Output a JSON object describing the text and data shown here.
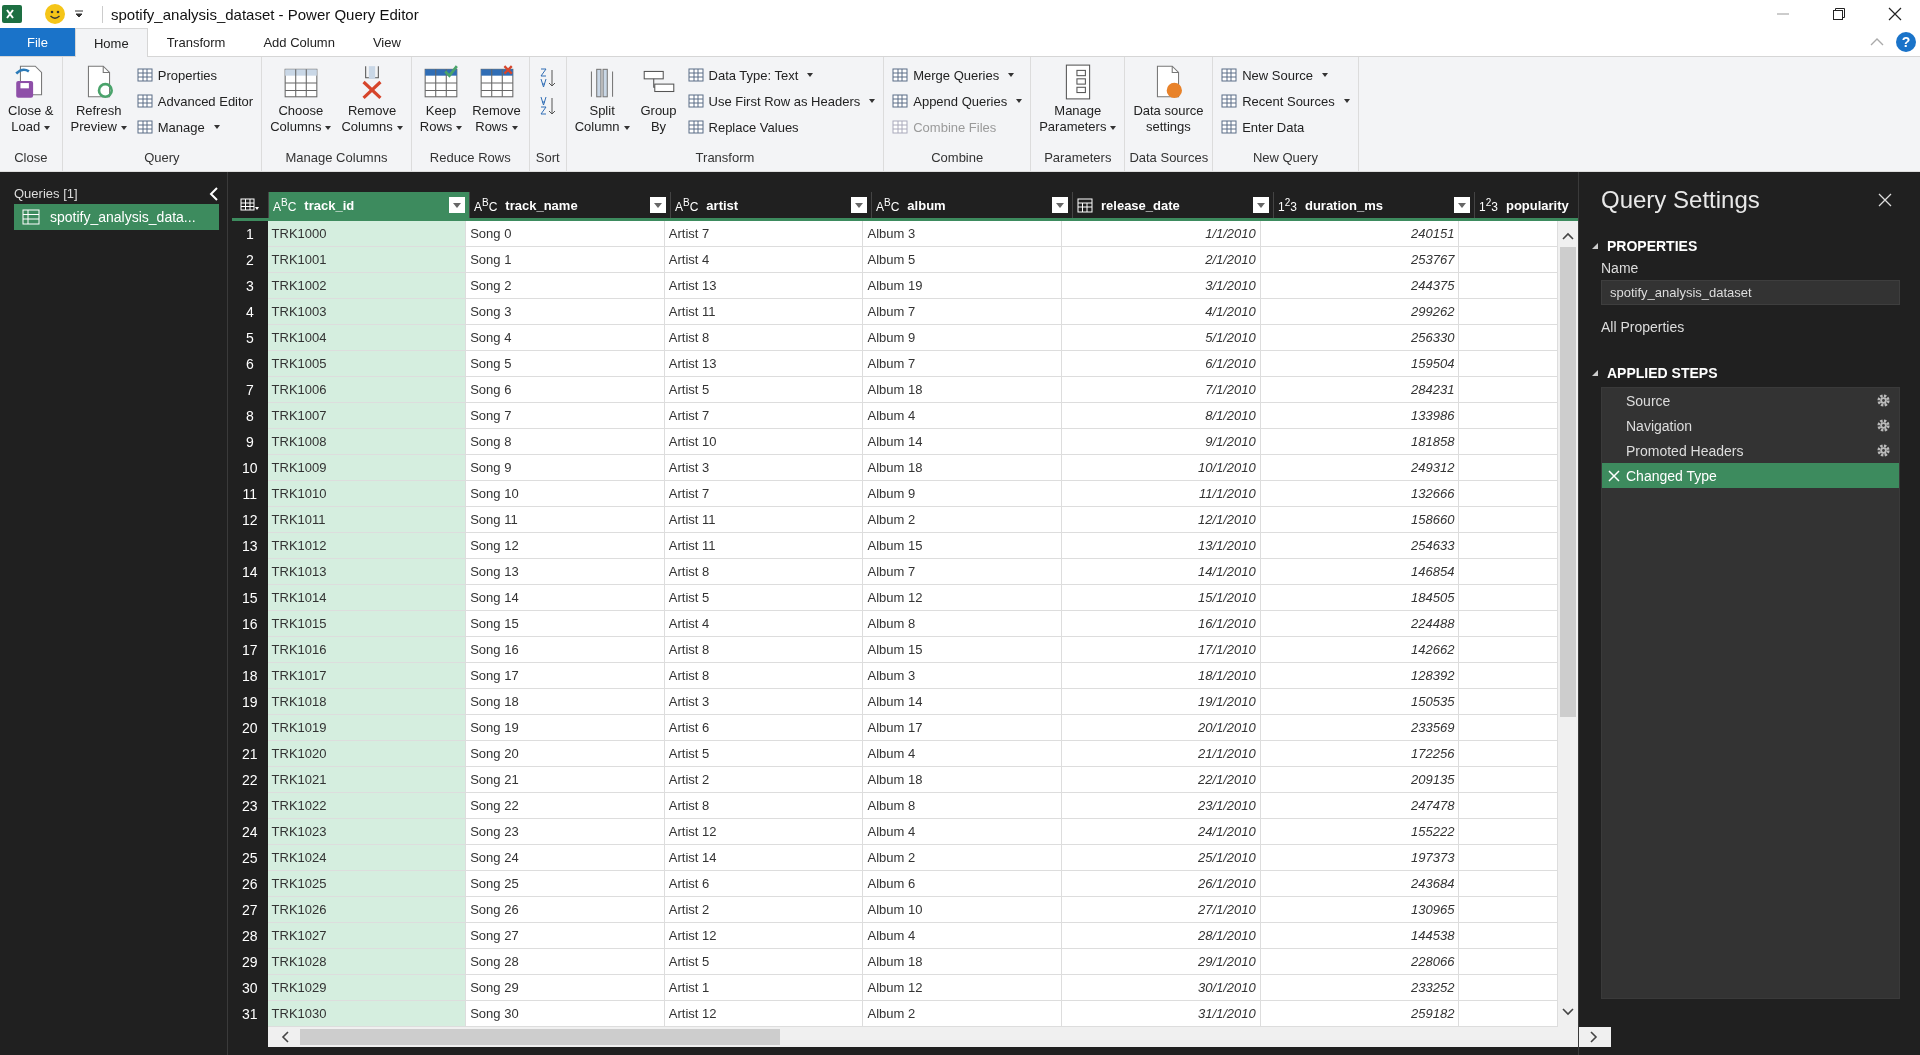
{
  "window": {
    "title": "spotify_analysis_dataset - Power Query Editor",
    "help": "?"
  },
  "tabs": [
    {
      "label": "File",
      "kind": "file",
      "selected": false
    },
    {
      "label": "Home",
      "kind": "tab",
      "selected": true
    },
    {
      "label": "Transform",
      "kind": "tab",
      "selected": false
    },
    {
      "label": "Add Column",
      "kind": "tab",
      "selected": false
    },
    {
      "label": "View",
      "kind": "tab",
      "selected": false
    }
  ],
  "ribbon": {
    "groups": [
      {
        "label": "Close",
        "columns": [
          {
            "kind": "large",
            "lines": [
              "Close &",
              "Load"
            ],
            "dropdown": true
          }
        ]
      },
      {
        "label": "Query",
        "columns": [
          {
            "kind": "large",
            "lines": [
              "Refresh",
              "Preview"
            ],
            "dropdown": true
          },
          {
            "kind": "stack",
            "items": [
              {
                "label": "Properties",
                "dropdown": false,
                "disabled": false
              },
              {
                "label": "Advanced Editor",
                "dropdown": false,
                "disabled": false
              },
              {
                "label": "Manage",
                "dropdown": true,
                "disabled": false
              }
            ]
          }
        ]
      },
      {
        "label": "Manage Columns",
        "columns": [
          {
            "kind": "large",
            "lines": [
              "Choose",
              "Columns"
            ],
            "dropdown": true
          },
          {
            "kind": "large",
            "lines": [
              "Remove",
              "Columns"
            ],
            "dropdown": true
          }
        ]
      },
      {
        "label": "Reduce Rows",
        "columns": [
          {
            "kind": "large",
            "lines": [
              "Keep",
              "Rows"
            ],
            "dropdown": true
          },
          {
            "kind": "large",
            "lines": [
              "Remove",
              "Rows"
            ],
            "dropdown": true
          }
        ]
      },
      {
        "label": "Sort",
        "columns": [
          {
            "kind": "sort"
          }
        ]
      },
      {
        "label": "Transform",
        "columns": [
          {
            "kind": "large",
            "lines": [
              "Split",
              "Column"
            ],
            "dropdown": true
          },
          {
            "kind": "large",
            "lines": [
              "Group",
              "By"
            ],
            "dropdown": false
          },
          {
            "kind": "stack",
            "items": [
              {
                "label": "Data Type: Text",
                "dropdown": true,
                "disabled": false
              },
              {
                "label": "Use First Row as Headers",
                "dropdown": true,
                "disabled": false
              },
              {
                "label": "Replace Values",
                "dropdown": false,
                "disabled": false
              }
            ]
          }
        ]
      },
      {
        "label": "Combine",
        "columns": [
          {
            "kind": "stack",
            "items": [
              {
                "label": "Merge Queries",
                "dropdown": true,
                "disabled": false
              },
              {
                "label": "Append Queries",
                "dropdown": true,
                "disabled": false
              },
              {
                "label": "Combine Files",
                "dropdown": false,
                "disabled": true
              }
            ]
          }
        ]
      },
      {
        "label": "Parameters",
        "columns": [
          {
            "kind": "large",
            "lines": [
              "Manage",
              "Parameters"
            ],
            "dropdown": true
          }
        ]
      },
      {
        "label": "Data Sources",
        "columns": [
          {
            "kind": "large",
            "lines": [
              "Data source",
              "settings"
            ],
            "dropdown": false
          }
        ]
      },
      {
        "label": "New Query",
        "columns": [
          {
            "kind": "stack",
            "items": [
              {
                "label": "New Source",
                "dropdown": true,
                "disabled": false
              },
              {
                "label": "Recent Sources",
                "dropdown": true,
                "disabled": false
              },
              {
                "label": "Enter Data",
                "dropdown": false,
                "disabled": false
              }
            ]
          }
        ]
      }
    ]
  },
  "queries": {
    "title": "Queries [1]",
    "items": [
      {
        "label": "spotify_analysis_data...",
        "selected": true
      }
    ]
  },
  "table": {
    "columns": [
      {
        "name": "track_id",
        "kind": "text",
        "badge": "A$^{B}$C",
        "selected": true
      },
      {
        "name": "track_name",
        "kind": "text",
        "badge": "A$^{B}$C",
        "selected": false
      },
      {
        "name": "artist",
        "kind": "text",
        "badge": "A$^{B}$C",
        "selected": false
      },
      {
        "name": "album",
        "kind": "text",
        "badge": "A$^{B}$C",
        "selected": false
      },
      {
        "name": "release_date",
        "kind": "date",
        "selected": false
      },
      {
        "name": "duration_ms",
        "kind": "number",
        "badge": "1$^{2}$3",
        "selected": false
      },
      {
        "name": "popularity",
        "kind": "number",
        "badge": "1$^{2}$3",
        "selected": false
      }
    ],
    "rows": [
      {
        "n": "1",
        "cells": [
          "TRK1000",
          "Song 0",
          "Artist 7",
          "Album 3",
          "1/1/2010",
          "240151"
        ]
      },
      {
        "n": "2",
        "cells": [
          "TRK1001",
          "Song 1",
          "Artist 4",
          "Album 5",
          "2/1/2010",
          "253767"
        ]
      },
      {
        "n": "3",
        "cells": [
          "TRK1002",
          "Song 2",
          "Artist 13",
          "Album 19",
          "3/1/2010",
          "244375"
        ]
      },
      {
        "n": "4",
        "cells": [
          "TRK1003",
          "Song 3",
          "Artist 11",
          "Album 7",
          "4/1/2010",
          "299262"
        ]
      },
      {
        "n": "5",
        "cells": [
          "TRK1004",
          "Song 4",
          "Artist 8",
          "Album 9",
          "5/1/2010",
          "256330"
        ]
      },
      {
        "n": "6",
        "cells": [
          "TRK1005",
          "Song 5",
          "Artist 13",
          "Album 7",
          "6/1/2010",
          "159504"
        ]
      },
      {
        "n": "7",
        "cells": [
          "TRK1006",
          "Song 6",
          "Artist 5",
          "Album 18",
          "7/1/2010",
          "284231"
        ]
      },
      {
        "n": "8",
        "cells": [
          "TRK1007",
          "Song 7",
          "Artist 7",
          "Album 4",
          "8/1/2010",
          "133986"
        ]
      },
      {
        "n": "9",
        "cells": [
          "TRK1008",
          "Song 8",
          "Artist 10",
          "Album 14",
          "9/1/2010",
          "181858"
        ]
      },
      {
        "n": "10",
        "cells": [
          "TRK1009",
          "Song 9",
          "Artist 3",
          "Album 18",
          "10/1/2010",
          "249312"
        ]
      },
      {
        "n": "11",
        "cells": [
          "TRK1010",
          "Song 10",
          "Artist 7",
          "Album 9",
          "11/1/2010",
          "132666"
        ]
      },
      {
        "n": "12",
        "cells": [
          "TRK1011",
          "Song 11",
          "Artist 11",
          "Album 2",
          "12/1/2010",
          "158660"
        ]
      },
      {
        "n": "13",
        "cells": [
          "TRK1012",
          "Song 12",
          "Artist 11",
          "Album 15",
          "13/1/2010",
          "254633"
        ]
      },
      {
        "n": "14",
        "cells": [
          "TRK1013",
          "Song 13",
          "Artist 8",
          "Album 7",
          "14/1/2010",
          "146854"
        ]
      },
      {
        "n": "15",
        "cells": [
          "TRK1014",
          "Song 14",
          "Artist 5",
          "Album 12",
          "15/1/2010",
          "184505"
        ]
      },
      {
        "n": "16",
        "cells": [
          "TRK1015",
          "Song 15",
          "Artist 4",
          "Album 8",
          "16/1/2010",
          "224488"
        ]
      },
      {
        "n": "17",
        "cells": [
          "TRK1016",
          "Song 16",
          "Artist 8",
          "Album 15",
          "17/1/2010",
          "142662"
        ]
      },
      {
        "n": "18",
        "cells": [
          "TRK1017",
          "Song 17",
          "Artist 8",
          "Album 3",
          "18/1/2010",
          "128392"
        ]
      },
      {
        "n": "19",
        "cells": [
          "TRK1018",
          "Song 18",
          "Artist 3",
          "Album 14",
          "19/1/2010",
          "150535"
        ]
      },
      {
        "n": "20",
        "cells": [
          "TRK1019",
          "Song 19",
          "Artist 6",
          "Album 17",
          "20/1/2010",
          "233569"
        ]
      },
      {
        "n": "21",
        "cells": [
          "TRK1020",
          "Song 20",
          "Artist 5",
          "Album 4",
          "21/1/2010",
          "172256"
        ]
      },
      {
        "n": "22",
        "cells": [
          "TRK1021",
          "Song 21",
          "Artist 2",
          "Album 18",
          "22/1/2010",
          "209135"
        ]
      },
      {
        "n": "23",
        "cells": [
          "TRK1022",
          "Song 22",
          "Artist 8",
          "Album 8",
          "23/1/2010",
          "247478"
        ]
      },
      {
        "n": "24",
        "cells": [
          "TRK1023",
          "Song 23",
          "Artist 12",
          "Album 4",
          "24/1/2010",
          "155222"
        ]
      },
      {
        "n": "25",
        "cells": [
          "TRK1024",
          "Song 24",
          "Artist 14",
          "Album 2",
          "25/1/2010",
          "197373"
        ]
      },
      {
        "n": "26",
        "cells": [
          "TRK1025",
          "Song 25",
          "Artist 6",
          "Album 6",
          "26/1/2010",
          "243684"
        ]
      },
      {
        "n": "27",
        "cells": [
          "TRK1026",
          "Song 26",
          "Artist 2",
          "Album 10",
          "27/1/2010",
          "130965"
        ]
      },
      {
        "n": "28",
        "cells": [
          "TRK1027",
          "Song 27",
          "Artist 12",
          "Album 4",
          "28/1/2010",
          "144538"
        ]
      },
      {
        "n": "29",
        "cells": [
          "TRK1028",
          "Song 28",
          "Artist 5",
          "Album 18",
          "29/1/2010",
          "228066"
        ]
      },
      {
        "n": "30",
        "cells": [
          "TRK1029",
          "Song 29",
          "Artist 1",
          "Album 12",
          "30/1/2010",
          "233252"
        ]
      },
      {
        "n": "31",
        "cells": [
          "TRK1030",
          "Song 30",
          "Artist 12",
          "Album 2",
          "31/1/2010",
          "259182"
        ]
      }
    ]
  },
  "settings": {
    "title": "Query Settings",
    "properties_heading": "PROPERTIES",
    "name_label": "Name",
    "name_value": "spotify_analysis_dataset",
    "all_properties": "All Properties",
    "steps_heading": "APPLIED STEPS",
    "steps": [
      {
        "label": "Source",
        "has_settings": true,
        "selected": false
      },
      {
        "label": "Navigation",
        "has_settings": true,
        "selected": false
      },
      {
        "label": "Promoted Headers",
        "has_settings": true,
        "selected": false
      },
      {
        "label": "Changed Type",
        "has_settings": false,
        "selected": true
      }
    ]
  }
}
